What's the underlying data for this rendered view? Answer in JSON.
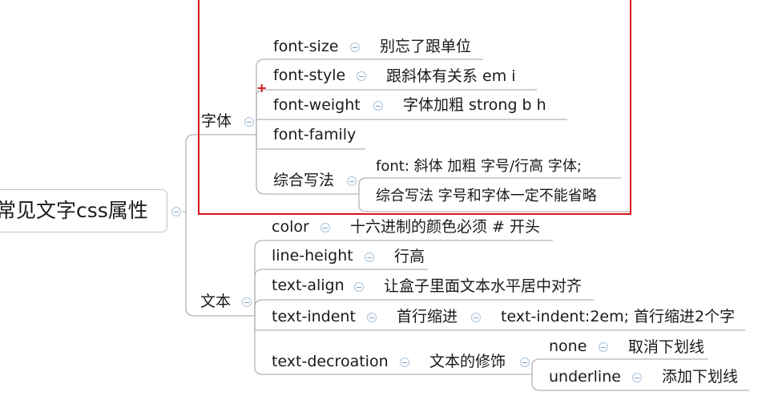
{
  "root": {
    "label": "常见文字css属性"
  },
  "branches": [
    {
      "label": "字体",
      "children": [
        {
          "label": "font-size",
          "note": "别忘了跟单位"
        },
        {
          "label": "font-style",
          "note": "跟斜体有关系  em  i"
        },
        {
          "label": "font-weight",
          "note": "字体加粗 strong  b  h"
        },
        {
          "label": "font-family"
        },
        {
          "label": "综合写法",
          "notes": [
            "font: 斜体  加粗  字号/行高  字体;",
            "综合写法 字号和字体一定不能省略"
          ]
        }
      ]
    },
    {
      "label": "文本",
      "children": [
        {
          "label": "color",
          "note": "十六进制的颜色必须 # 开头"
        },
        {
          "label": "line-height",
          "note": "行高"
        },
        {
          "label": "text-align",
          "note": "让盒子里面文本水平居中对齐"
        },
        {
          "label": "text-indent",
          "note": "首行缩进",
          "subnote": "text-indent:2em; 首行缩进2个字"
        },
        {
          "label": "text-decroation",
          "note": "文本的修饰",
          "options": [
            {
              "label": "none",
              "note": "取消下划线"
            },
            {
              "label": "underline",
              "note": "添加下划线"
            }
          ]
        }
      ]
    }
  ],
  "colors": {
    "highlight": "#d8141c",
    "line": "#b4b4b4",
    "toggle": "#aac3dc"
  }
}
